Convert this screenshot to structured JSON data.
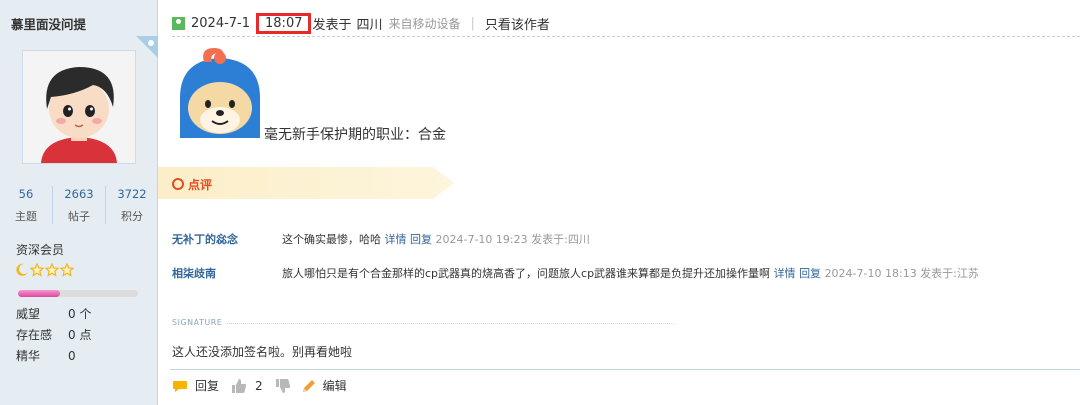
{
  "author": {
    "name": "慕里面没问提",
    "stats": [
      {
        "value": "56",
        "label": "主题"
      },
      {
        "value": "2663",
        "label": "帖子"
      },
      {
        "value": "3722",
        "label": "积分"
      }
    ],
    "rank": "资深会员",
    "progress": 0.35,
    "attributes": [
      {
        "key": "威望",
        "value": "0 个"
      },
      {
        "key": "存在感",
        "value": "0 点"
      },
      {
        "key": "精华",
        "value": "0"
      }
    ]
  },
  "post": {
    "date": "2024-7-1",
    "time": "18:07",
    "posted_label": "发表于",
    "location": "四川",
    "device": "来自移动设备",
    "only_author": "只看该作者",
    "content": "毫无新手保护期的职业：合金"
  },
  "comments_header": "点评",
  "comments": [
    {
      "user": "无补丁的惢念",
      "text": "这个确实最惨，哈哈",
      "detail": "详情",
      "reply": "回复",
      "timestamp": "2024-7-10 19:23 发表于:四川"
    },
    {
      "user": "相柒歧南",
      "text": "旅人哪怕只是有个合金那样的cp武器真的烧高香了，问题旅人cp武器谁来算都是负提升还加操作量啊",
      "detail": "详情",
      "reply": "回复",
      "timestamp": "2024-7-10 18:13 发表于:江苏"
    }
  ],
  "signature_label": "SIGNATURE",
  "signature": "这人还没添加签名啦。别再看她啦",
  "footer": {
    "reply": "回复",
    "like_count": "2",
    "edit": "编辑"
  },
  "colors": {
    "link": "#336699",
    "highlight_border": "#e8292a",
    "comment_accent": "#e54c1f",
    "sidebar_bg": "#e5edf2"
  }
}
